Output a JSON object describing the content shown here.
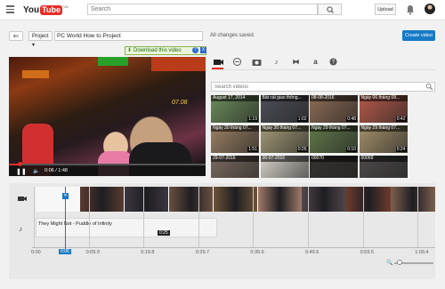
{
  "header": {
    "logo_you": "You",
    "logo_tube": "Tube",
    "logo_country": "VN",
    "search_placeholder": "Search",
    "upload_label": "Upload"
  },
  "editor": {
    "back_label": "⇐",
    "project_label": "Project ▾",
    "project_title": "PC World How to Project",
    "save_status": "All changes saved.",
    "create_label": "Create video"
  },
  "player": {
    "timestamp": "07.08",
    "time_readout": "0:06 / 1:48",
    "download_label": "Download this video",
    "help_label": "?",
    "close_label": "X",
    "progress_fraction": 0.055
  },
  "tabs": {
    "icons": [
      "video-camera-icon",
      "cc-music-icon",
      "photo-camera-icon",
      "music-note-icon",
      "transitions-icon",
      "text-icon",
      "help-icon"
    ],
    "active": "video-camera-icon"
  },
  "video_search": {
    "placeholder": "Search videos"
  },
  "library": [
    {
      "title": "August 17, 2014",
      "duration": "1:19",
      "color": "#6b8c5a"
    },
    {
      "title": "Bất cái giao thông...",
      "duration": "1:02",
      "color": "#4d4e57"
    },
    {
      "title": "08-08-2016",
      "duration": "0:48",
      "color": "#8c6c55"
    },
    {
      "title": "Ngày 06 tháng 08...",
      "duration": "0:42",
      "color": "#b55a4a"
    },
    {
      "title": "Ngày 30 tháng 07...",
      "duration": "1:51",
      "color": "#9b8064"
    },
    {
      "title": "Ngày 30 tháng 07...",
      "duration": "0:26",
      "color": "#a39a76"
    },
    {
      "title": "Ngày 29 tháng 07...",
      "duration": "0:10",
      "color": "#607848"
    },
    {
      "title": "Ngày 29 tháng 07...",
      "duration": "0:24",
      "color": "#a4906b"
    },
    {
      "title": "29-07-2016",
      "duration": "",
      "color": "#7a6a60"
    },
    {
      "title": "26-07-2016",
      "duration": "",
      "color": "#d8d2ca"
    },
    {
      "title": "00070",
      "duration": "",
      "color": "#35322e"
    },
    {
      "title": "00069",
      "duration": "",
      "color": "#4c4a49"
    }
  ],
  "timeline": {
    "audio_title": "They Might Not - Puddle of Infinity",
    "audio_duration": "0:25",
    "playhead_time": "0:06",
    "ticks": [
      "0:00",
      "0:09.9",
      "0:19.8",
      "0:29.7",
      "0:39.6",
      "0:49.6",
      "0:59.5",
      "1:09.4"
    ],
    "clip_colors": [
      "#5a3a30",
      "#3c3640",
      "#6a5040",
      "#6c5338",
      "#a07a6a",
      "#51474d",
      "#6e3b2d",
      "#7d6050"
    ]
  }
}
